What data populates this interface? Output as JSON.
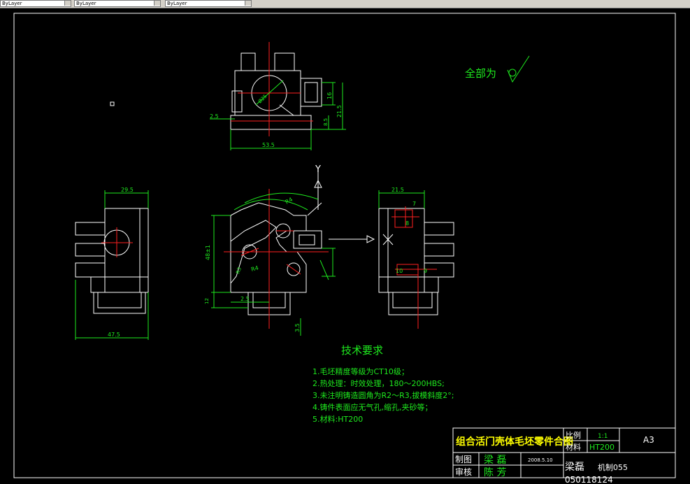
{
  "toolbar": {
    "fields": [
      "ByLayer",
      "ByLayer",
      "ByLayer"
    ]
  },
  "drawing": {
    "roughness_note": "全部为",
    "axis_label_y": "Y",
    "top_view_dims": {
      "d1": "2.5",
      "d2": "53.5",
      "d3": "16",
      "d4": "21.5",
      "d5": "8.5",
      "dia": "Ø25"
    },
    "front_view_dims": {
      "height": "48±1",
      "bottom": "12",
      "d1": "2.5",
      "d2": "3.5",
      "r1": "R4",
      "r2": "R4",
      "r3": "R3"
    },
    "left_view_dims": {
      "top": "29.5",
      "bottom": "47.5"
    },
    "right_view_dims": {
      "top": "21.5",
      "n7": "7",
      "n8": "8",
      "n10": "10",
      "n9": "9"
    },
    "tech_req": {
      "title": "技术要求",
      "items": [
        "1.毛坯精度等级为CT10级；",
        "2.热处理：时效处理，180～200HBS;",
        "3.未注明铸造圆角为R2～R3,拔模斜度2°;",
        "4.铸件表面应无气孔,缩孔,夹砂等；",
        "5.材料:HT200"
      ]
    },
    "title_block": {
      "part_name": "组合活门壳体毛坯零件合图",
      "scale_label": "比例",
      "scale_value": "1:1",
      "material_label": "材料",
      "material_value": "HT200",
      "sheet_size": "A3",
      "drawn_label": "制图",
      "drawn_name": "梁 磊",
      "drawn_date": "2008.5.10",
      "check_label": "审核",
      "check_name": "陈 芳",
      "student_name": "梁磊",
      "class_name": "机制055",
      "student_id": "050118124"
    }
  },
  "colors": {
    "background": "#000000",
    "lines": "#ffffff",
    "dims": "#1eea1e",
    "center": "#ff2020",
    "title": "#ffff00"
  }
}
